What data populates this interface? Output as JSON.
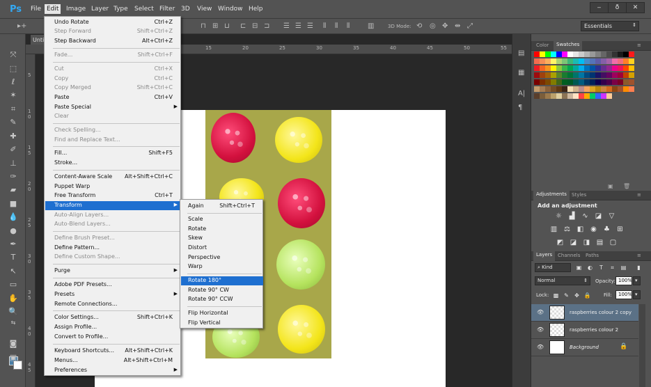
{
  "app": {
    "logo": "Ps"
  },
  "menubar": {
    "items": [
      "File",
      "Edit",
      "Image",
      "Layer",
      "Type",
      "Select",
      "Filter",
      "3D",
      "View",
      "Window",
      "Help"
    ]
  },
  "window_controls": {
    "minimize": "‒",
    "restore": "ð",
    "close": "✕"
  },
  "options_bar": {
    "mode_3d_label": "3D Mode:",
    "workspace": "Essentials"
  },
  "document": {
    "tab_title": "Unti",
    "ruler_h": [
      "15",
      "20",
      "25",
      "30",
      "35",
      "40",
      "45",
      "50",
      "55"
    ],
    "ruler_v": [
      "5",
      "1 0",
      "1 5",
      "2 0",
      "2 5",
      "3 0",
      "3 5",
      "4 0",
      "4 5",
      "5 0"
    ]
  },
  "edit_menu": {
    "items": [
      {
        "label": "Undo Rotate",
        "shortcut": "Ctrl+Z",
        "disabled": false
      },
      {
        "label": "Step Forward",
        "shortcut": "Shift+Ctrl+Z",
        "disabled": true
      },
      {
        "label": "Step Backward",
        "shortcut": "Alt+Ctrl+Z",
        "disabled": false
      },
      {
        "label": "Fade...",
        "shortcut": "Shift+Ctrl+F",
        "disabled": true
      },
      {
        "label": "Cut",
        "shortcut": "Ctrl+X",
        "disabled": true
      },
      {
        "label": "Copy",
        "shortcut": "Ctrl+C",
        "disabled": true
      },
      {
        "label": "Copy Merged",
        "shortcut": "Shift+Ctrl+C",
        "disabled": true
      },
      {
        "label": "Paste",
        "shortcut": "Ctrl+V",
        "disabled": false
      },
      {
        "label": "Paste Special",
        "shortcut": "",
        "disabled": false,
        "submenu": true
      },
      {
        "label": "Clear",
        "shortcut": "",
        "disabled": true
      },
      {
        "label": "Check Spelling...",
        "shortcut": "",
        "disabled": true
      },
      {
        "label": "Find and Replace Text...",
        "shortcut": "",
        "disabled": true
      },
      {
        "label": "Fill...",
        "shortcut": "Shift+F5",
        "disabled": false
      },
      {
        "label": "Stroke...",
        "shortcut": "",
        "disabled": false
      },
      {
        "label": "Content-Aware Scale",
        "shortcut": "Alt+Shift+Ctrl+C",
        "disabled": false
      },
      {
        "label": "Puppet Warp",
        "shortcut": "",
        "disabled": false
      },
      {
        "label": "Free Transform",
        "shortcut": "Ctrl+T",
        "disabled": false
      },
      {
        "label": "Transform",
        "shortcut": "",
        "disabled": false,
        "submenu": true,
        "selected": true
      },
      {
        "label": "Auto-Align Layers...",
        "shortcut": "",
        "disabled": true
      },
      {
        "label": "Auto-Blend Layers...",
        "shortcut": "",
        "disabled": true
      },
      {
        "label": "Define Brush Preset...",
        "shortcut": "",
        "disabled": true
      },
      {
        "label": "Define Pattern...",
        "shortcut": "",
        "disabled": false
      },
      {
        "label": "Define Custom Shape...",
        "shortcut": "",
        "disabled": true
      },
      {
        "label": "Purge",
        "shortcut": "",
        "disabled": false,
        "submenu": true
      },
      {
        "label": "Adobe PDF Presets...",
        "shortcut": "",
        "disabled": false
      },
      {
        "label": "Presets",
        "shortcut": "",
        "disabled": false,
        "submenu": true
      },
      {
        "label": "Remote Connections...",
        "shortcut": "",
        "disabled": false
      },
      {
        "label": "Color Settings...",
        "shortcut": "Shift+Ctrl+K",
        "disabled": false
      },
      {
        "label": "Assign Profile...",
        "shortcut": "",
        "disabled": false
      },
      {
        "label": "Convert to Profile...",
        "shortcut": "",
        "disabled": false
      },
      {
        "label": "Keyboard Shortcuts...",
        "shortcut": "Alt+Shift+Ctrl+K",
        "disabled": false
      },
      {
        "label": "Menus...",
        "shortcut": "Alt+Shift+Ctrl+M",
        "disabled": false
      },
      {
        "label": "Preferences",
        "shortcut": "",
        "disabled": false,
        "submenu": true
      }
    ]
  },
  "transform_menu": {
    "items": [
      {
        "label": "Again",
        "shortcut": "Shift+Ctrl+T"
      },
      {
        "label": "Scale",
        "shortcut": ""
      },
      {
        "label": "Rotate",
        "shortcut": ""
      },
      {
        "label": "Skew",
        "shortcut": ""
      },
      {
        "label": "Distort",
        "shortcut": ""
      },
      {
        "label": "Perspective",
        "shortcut": ""
      },
      {
        "label": "Warp",
        "shortcut": ""
      },
      {
        "label": "Rotate 180°",
        "shortcut": "",
        "selected": true
      },
      {
        "label": "Rotate 90° CW",
        "shortcut": ""
      },
      {
        "label": "Rotate 90° CCW",
        "shortcut": ""
      },
      {
        "label": "Flip Horizontal",
        "shortcut": ""
      },
      {
        "label": "Flip Vertical",
        "shortcut": ""
      }
    ]
  },
  "color_panel": {
    "tabs": [
      "Color",
      "Swatches"
    ],
    "active_tab": "Swatches"
  },
  "adjustments_panel": {
    "tabs": [
      "Adjustments",
      "Styles"
    ],
    "title": "Add an adjustment"
  },
  "layers_panel": {
    "tabs": [
      "Layers",
      "Channels",
      "Paths"
    ],
    "filter_kind": "Kind",
    "blend_mode": "Normal",
    "opacity_label": "Opacity:",
    "opacity_value": "100%",
    "lock_label": "Lock:",
    "fill_label": "Fill:",
    "fill_value": "100%",
    "layers": [
      {
        "name": "raspberries colour 2 copy",
        "active": true
      },
      {
        "name": "raspberries colour 2",
        "active": false
      },
      {
        "name": "Background",
        "active": false,
        "locked": true
      }
    ]
  },
  "colors": {
    "selection": "#1e6fd0",
    "artboard": "#a8a74a",
    "ps_blue": "#34a8f2"
  }
}
